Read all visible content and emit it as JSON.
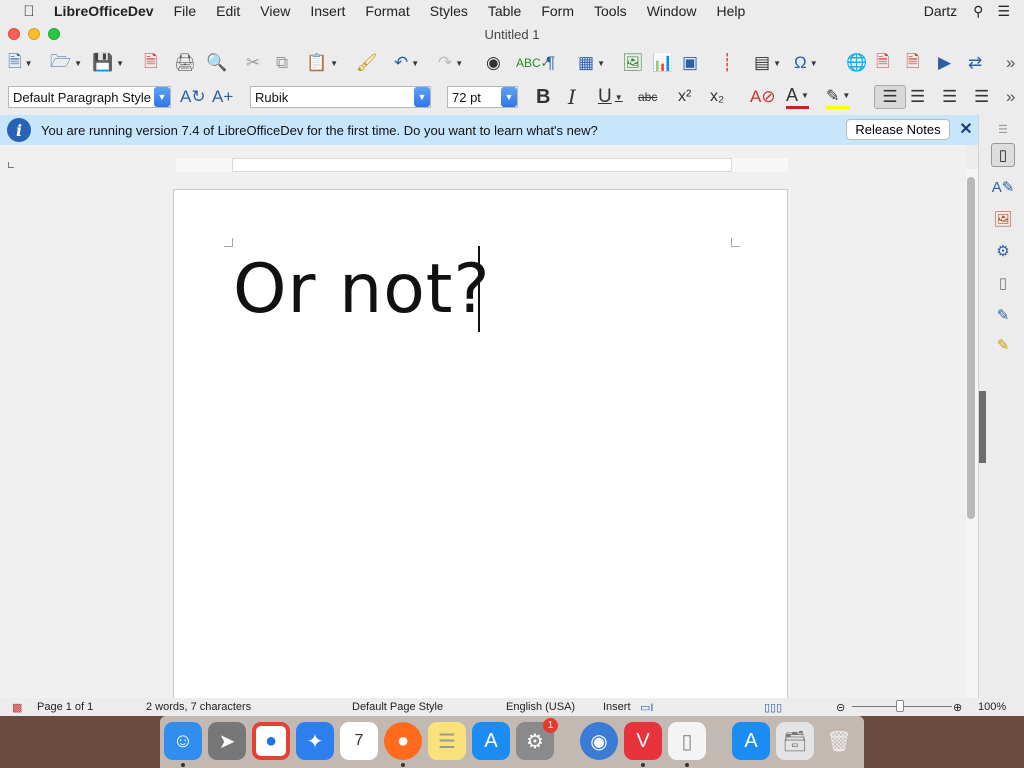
{
  "menubar": {
    "app_name": "LibreOfficeDev",
    "menus": [
      "File",
      "Edit",
      "View",
      "Insert",
      "Format",
      "Styles",
      "Table",
      "Form",
      "Tools",
      "Window",
      "Help"
    ],
    "user": "Dartz"
  },
  "window": {
    "title": "Untitled 1"
  },
  "formatting": {
    "paragraph_style": "Default Paragraph Style",
    "font_name": "Rubik",
    "font_size": "72 pt"
  },
  "infobar": {
    "message": "You are running version 7.4 of LibreOfficeDev for the first time. Do you want to learn what's new?",
    "button_label": "Release Notes"
  },
  "document": {
    "text": "Or not?"
  },
  "statusbar": {
    "page": "Page 1 of 1",
    "word_count": "2 words, 7 characters",
    "page_style": "Default Page Style",
    "language": "English (USA)",
    "mode": "Insert",
    "zoom": "100%"
  },
  "dock": {
    "badge_count": "1"
  },
  "colors": {
    "accent": "#2f76e4",
    "infobar": "#c8e6fb",
    "desktop": "#6b4b3e"
  }
}
